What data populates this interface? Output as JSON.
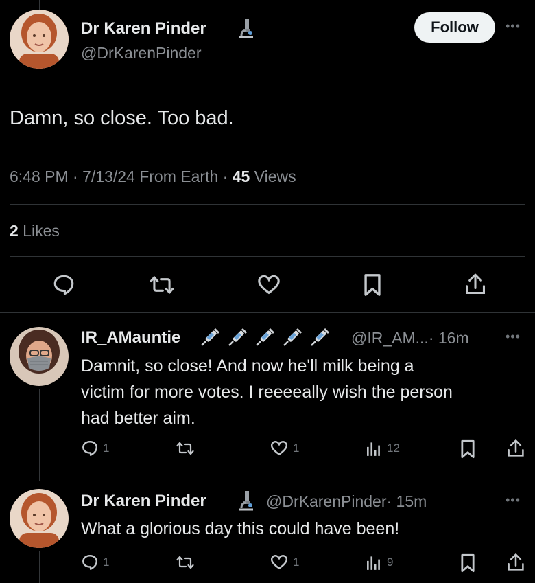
{
  "main_tweet": {
    "display_name": "Dr Karen Pinder",
    "handle": "@DrKarenPinder",
    "badge_icon": "microscope-icon",
    "follow_label": "Follow",
    "text": "Damn, so close. Too bad.",
    "timestamp": "6:48 PM · 7/13/24 From Earth · ",
    "views_count": "45",
    "views_label": " Views",
    "likes_count": "2",
    "likes_label": " Likes"
  },
  "replies": [
    {
      "display_name": "IR_AMauntie",
      "badge_icons": [
        "syringe-icon",
        "syringe-icon",
        "syringe-icon",
        "syringe-icon",
        "syringe-icon"
      ],
      "handle": "@IR_AM...",
      "time": "· 16m",
      "text_lines": [
        "Damnit, so close! And now he'll milk being a",
        "victim for more votes. I reeeeally wish the person",
        "had better aim."
      ],
      "replies": "1",
      "likes": "1",
      "views": "12"
    },
    {
      "display_name": "Dr Karen Pinder",
      "badge_icon": "microscope-icon",
      "handle": "@DrKarenPinder",
      "time": "· 15m",
      "text": "What a glorious day this could have been!",
      "replies": "1",
      "likes": "1",
      "views": "9"
    }
  ],
  "colors": {
    "background": "#000000",
    "text": "#e7e9ea",
    "muted": "#71767b",
    "divider": "#2f3336",
    "follow_bg": "#eff3f4"
  }
}
